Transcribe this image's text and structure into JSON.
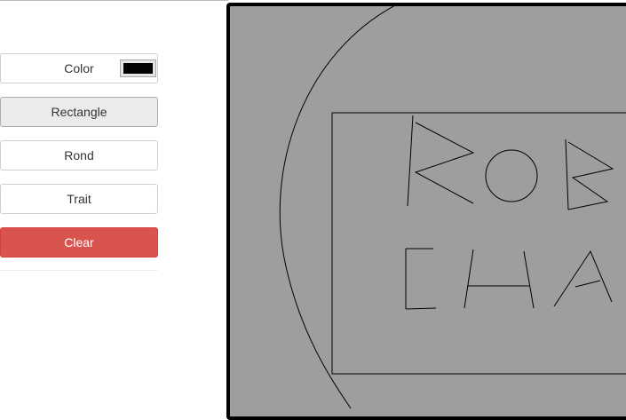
{
  "toolbar": {
    "color_label": "Color",
    "rectangle_label": "Rectangle",
    "rond_label": "Rond",
    "trait_label": "Trait",
    "clear_label": "Clear",
    "selected_tool": "Rectangle",
    "current_color": "#000000"
  },
  "canvas": {
    "background": "#9e9e9e"
  },
  "colors": {
    "clear_button": "#d9534f",
    "active_button": "#ebebeb"
  }
}
